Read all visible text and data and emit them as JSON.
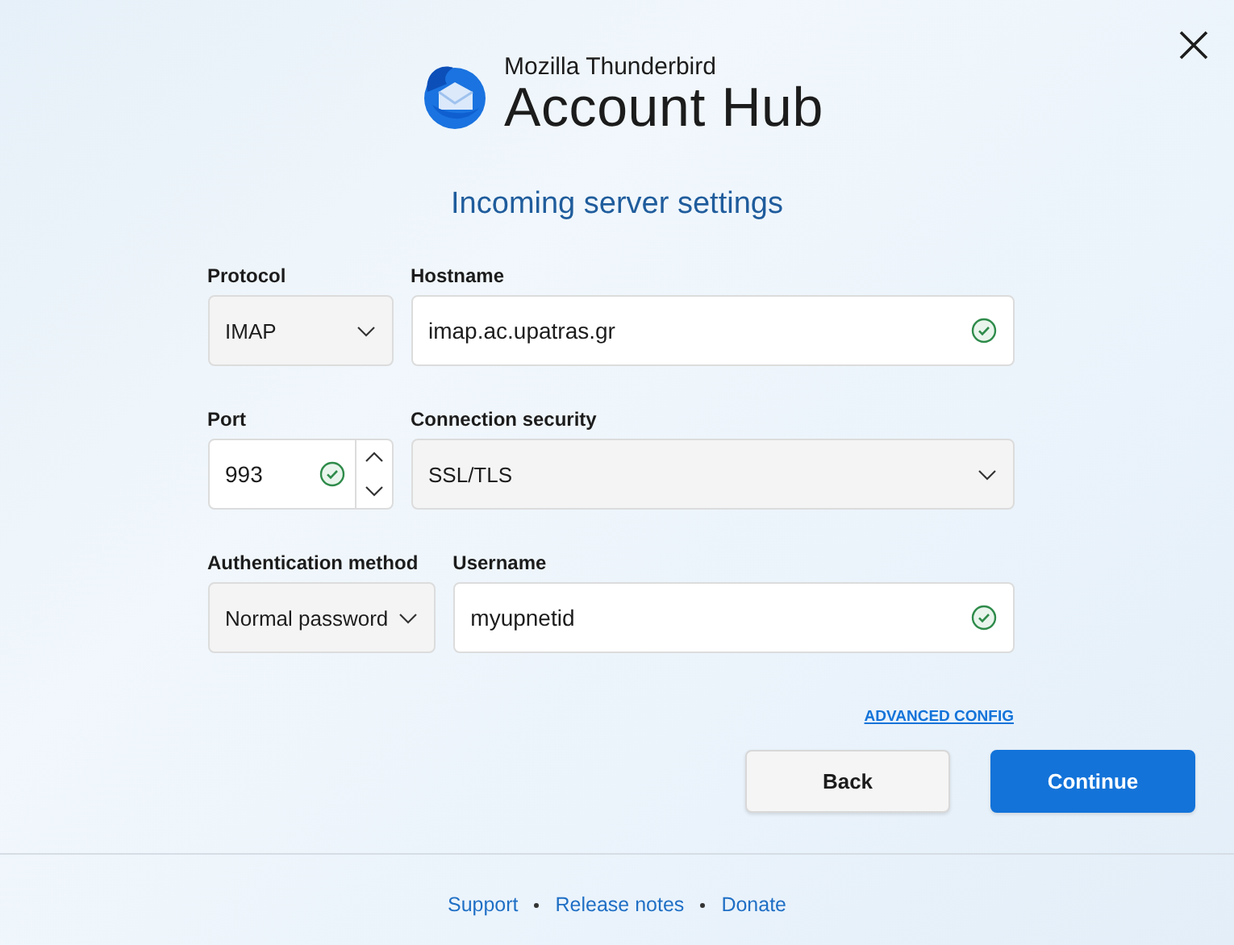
{
  "header": {
    "brand": "Mozilla Thunderbird",
    "product": "Account Hub"
  },
  "title": "Incoming server settings",
  "rows": [
    [
      {
        "label": "Protocol",
        "kind": "select",
        "value": "IMAP"
      },
      {
        "label": "Hostname",
        "kind": "text",
        "value": "imap.ac.upatras.gr",
        "valid": true
      }
    ],
    [
      {
        "label": "Port",
        "kind": "number",
        "value": "993",
        "valid": true
      },
      {
        "label": "Connection security",
        "kind": "select",
        "value": "SSL/TLS"
      }
    ],
    [
      {
        "label": "Authentication method",
        "kind": "select",
        "value": "Normal password"
      },
      {
        "label": "Username",
        "kind": "text",
        "value": "myupnetid",
        "valid": true
      }
    ]
  ],
  "advanced_link": "ADVANCED CONFIG",
  "buttons": [
    {
      "label": "Back",
      "primary": false
    },
    {
      "label": "Continue",
      "primary": true
    }
  ],
  "footer_links": [
    "Support",
    "Release notes",
    "Donate"
  ]
}
